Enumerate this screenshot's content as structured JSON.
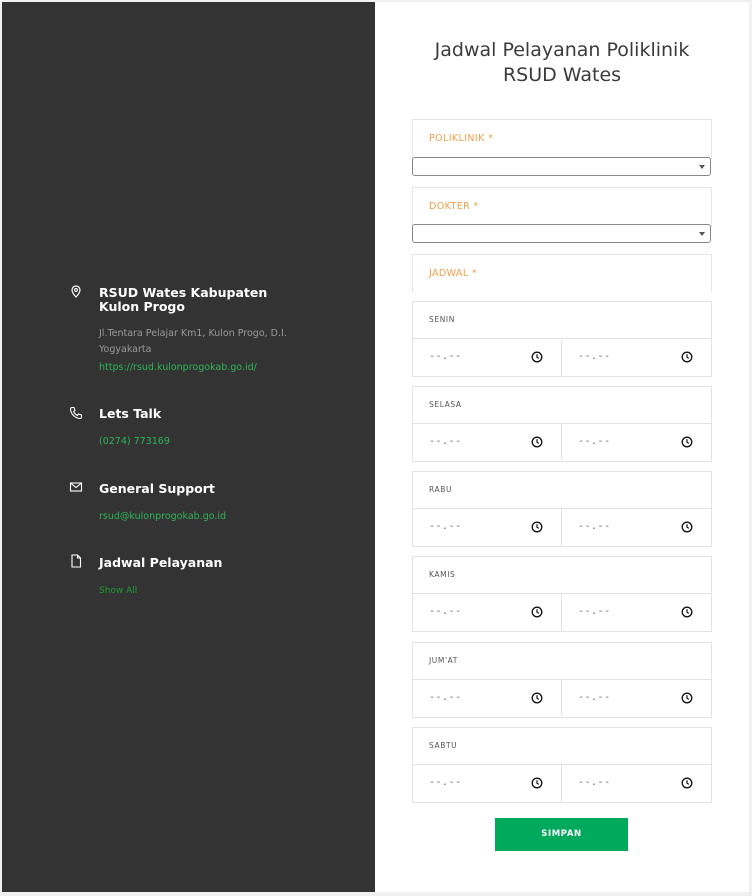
{
  "contact": {
    "address": {
      "icon": "map-pin-icon",
      "title": "RSUD Wates Kabupaten Kulon Progo",
      "text": "Jl.Tentara Pelajar Km1, Kulon Progo, D.I. Yogyakarta",
      "link": "https://rsud.kulonprogokab.go.id/"
    },
    "talk": {
      "icon": "phone-icon",
      "title": "Lets Talk",
      "link": "(0274) 773169"
    },
    "support": {
      "icon": "mail-icon",
      "title": "General Support",
      "link": "rsud@kulonprogokab.go.id"
    },
    "schedule": {
      "icon": "document-icon",
      "title": "Jadwal Pelayanan",
      "link": "Show All"
    }
  },
  "form": {
    "title": "Jadwal Pelayanan Poliklinik RSUD Wates",
    "poliklinik_label": "POLIKLINIK *",
    "poliklinik_value": "",
    "dokter_label": "DOKTER *",
    "dokter_value": "",
    "jadwal_label": "JADWAL *",
    "time_placeholder": "--.--",
    "days": [
      {
        "label": "SENIN",
        "start": "--.--",
        "end": "--.--"
      },
      {
        "label": "SELASA",
        "start": "--.--",
        "end": "--.--"
      },
      {
        "label": "RABU",
        "start": "--.--",
        "end": "--.--"
      },
      {
        "label": "KAMIS",
        "start": "--.--",
        "end": "--.--"
      },
      {
        "label": "JUM'AT",
        "start": "--.--",
        "end": "--.--"
      },
      {
        "label": "SABTU",
        "start": "--.--",
        "end": "--.--"
      }
    ],
    "submit_label": "SIMPAN"
  },
  "colors": {
    "left_bg": "#333333",
    "accent_label": "#f0a04b",
    "link_green": "#2fb457",
    "button_green": "#00a95c"
  }
}
